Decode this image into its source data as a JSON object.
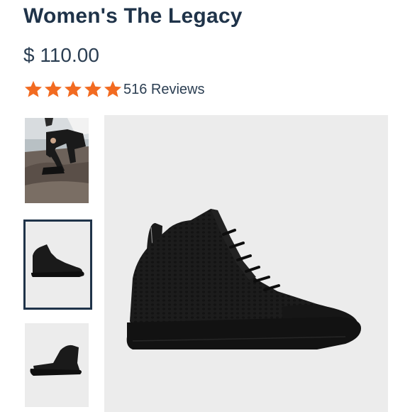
{
  "product": {
    "title": "Women's The Legacy",
    "price": "$ 110.00",
    "rating_stars": 5,
    "reviews_label": "516 Reviews"
  },
  "colors": {
    "title": "#1f3349",
    "text": "#2b3e52",
    "star": "#f26b21",
    "image_bg": "#ececec",
    "selected_border": "#1f3349"
  },
  "gallery": {
    "thumbnails": [
      {
        "icon": "lifestyle-photo",
        "selected": false
      },
      {
        "icon": "shoe-side-photo",
        "selected": true
      },
      {
        "icon": "shoe-angle-photo",
        "selected": false
      }
    ],
    "main_image": {
      "icon": "black-high-top-sneaker-photo"
    }
  }
}
